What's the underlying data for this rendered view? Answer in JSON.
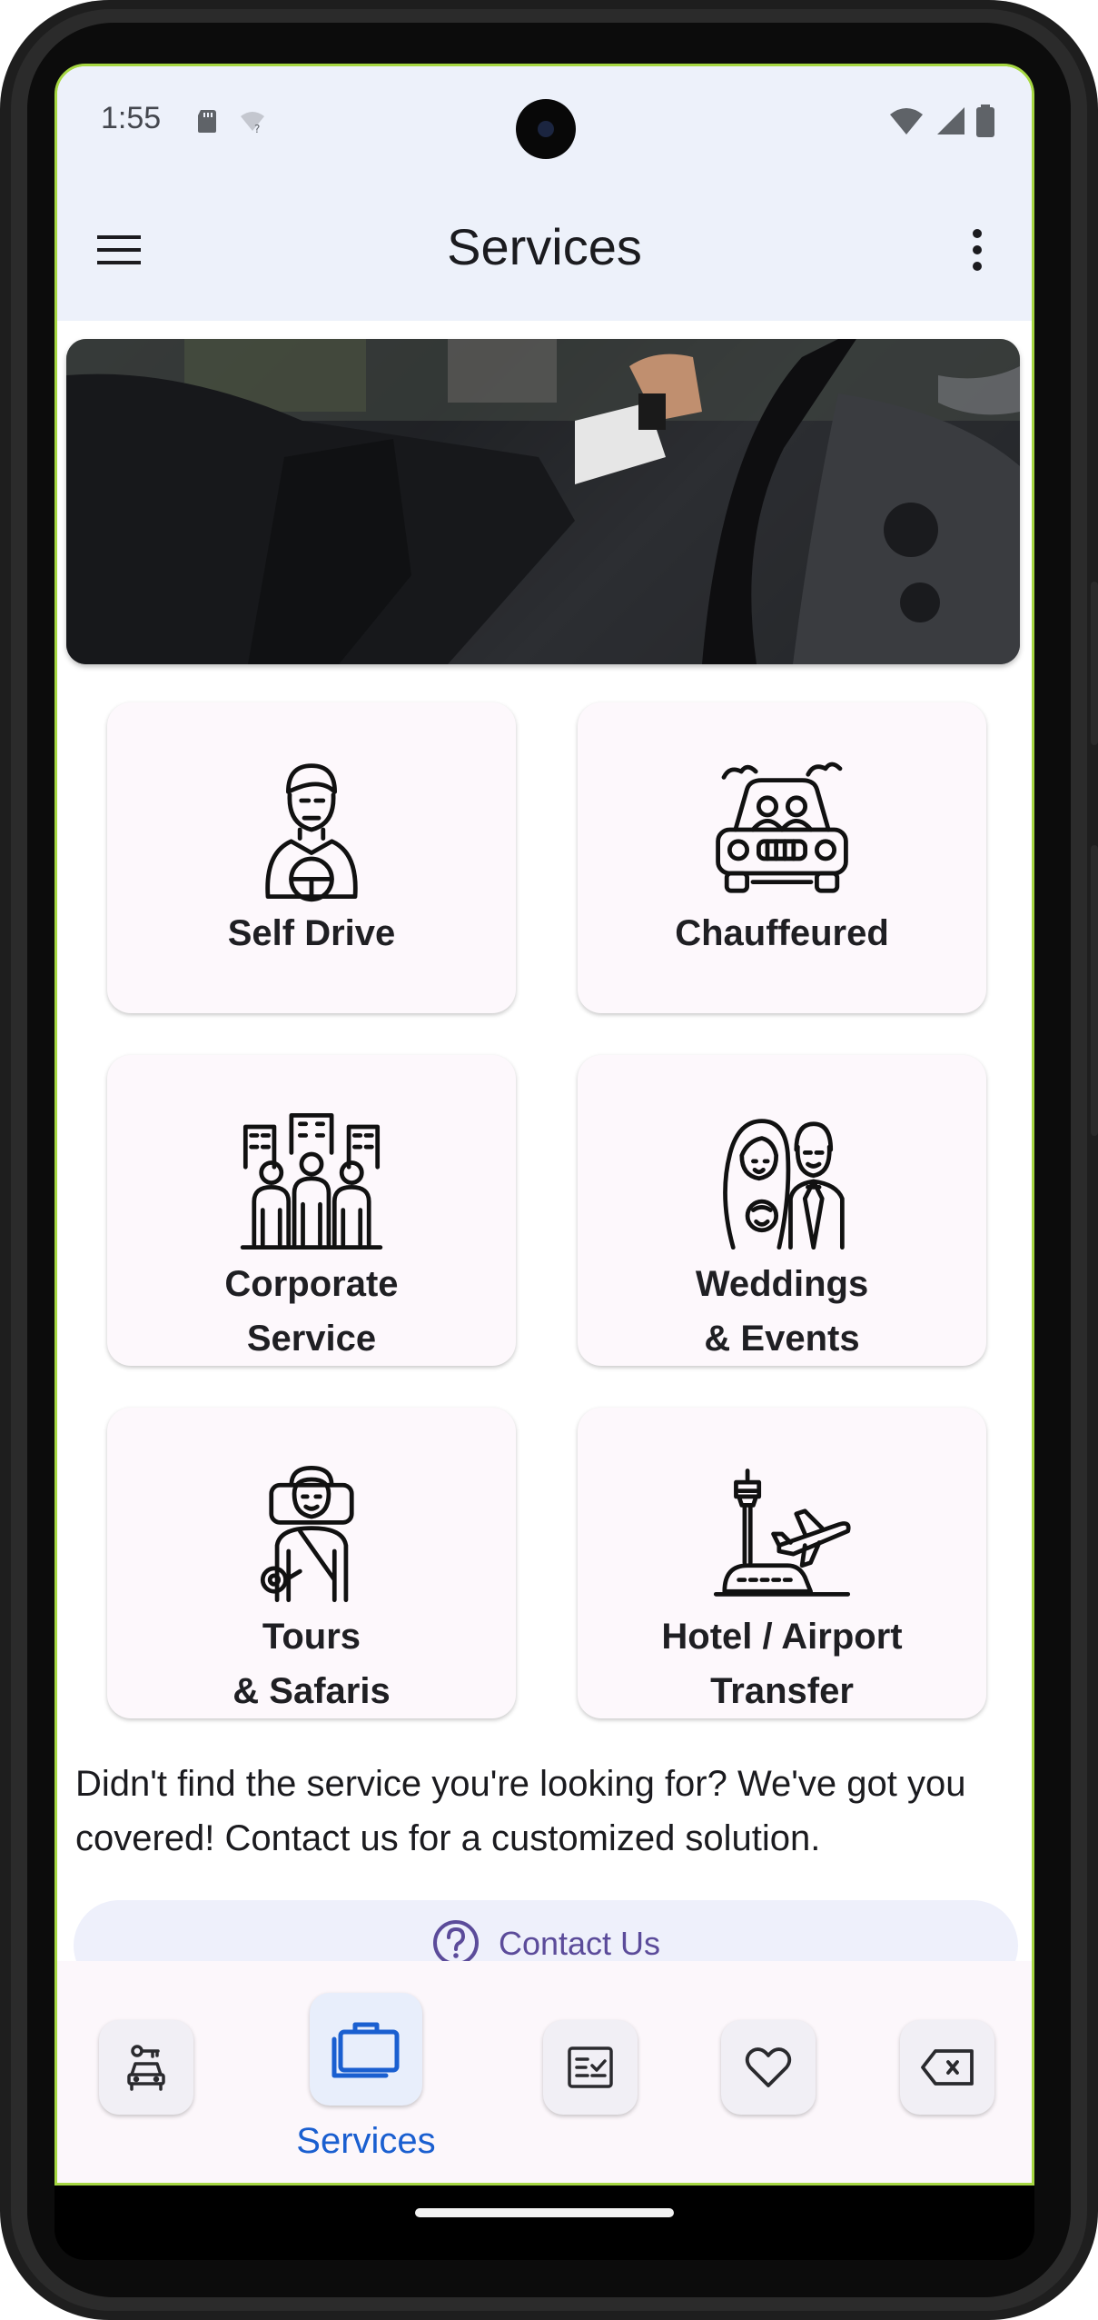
{
  "status_bar": {
    "time": "1:55"
  },
  "app_bar": {
    "title": "Services",
    "menu_icon": "hamburger-menu-icon",
    "more_icon": "more-vert-icon"
  },
  "services": [
    {
      "label": "Self Drive",
      "icon": "driver-icon"
    },
    {
      "label": "Chauffeured",
      "icon": "chauffeur-car-icon"
    },
    {
      "label": "Corporate\nService",
      "icon": "corporate-team-icon"
    },
    {
      "label": "Weddings\n& Events",
      "icon": "wedding-couple-icon"
    },
    {
      "label": "Tours\n& Safaris",
      "icon": "traveler-backpack-icon"
    },
    {
      "label": "Hotel / Airport\nTransfer",
      "icon": "airport-plane-icon"
    }
  ],
  "promo": {
    "text": "Didn't find the service you're looking for? We've got you covered! Contact us for a customized solution.",
    "contact_label": "Contact Us"
  },
  "bottom_nav": {
    "items": [
      {
        "icon": "car-rental-icon"
      },
      {
        "icon": "briefcase-icon",
        "label": "Services",
        "active": true
      },
      {
        "icon": "checklist-icon"
      },
      {
        "icon": "heart-icon"
      },
      {
        "icon": "tag-icon"
      }
    ]
  },
  "colors": {
    "accent": "#1a5fd0",
    "app_bar_bg": "#edf1fa",
    "card_bg": "#fdf8fc",
    "contact_text": "#5b4b9a"
  }
}
